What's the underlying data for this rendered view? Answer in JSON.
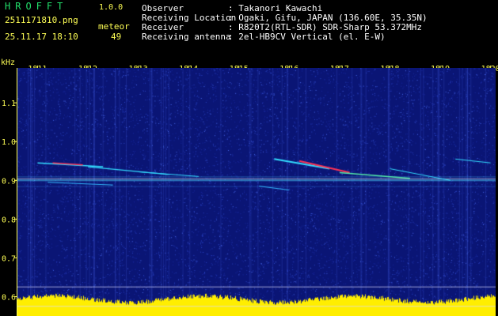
{
  "header": {
    "app_title": "HROFFT",
    "app_version": "1.0.0",
    "file_name": "2511171810.png",
    "date_time": "25.11.17 18:10",
    "meteor_label": "meteor",
    "meteor_count": "49"
  },
  "info": [
    {
      "label": "Observer",
      "value": ": Takanori Kawachi"
    },
    {
      "label": "Receiving Location",
      "value": ": Ogaki, Gifu, JAPAN (136.60E, 35.35N)"
    },
    {
      "label": "Receiver",
      "value": ": R820T2(RTL-SDR) SDR-Sharp 53.372MHz"
    },
    {
      "label": "Receiving antenna",
      "value": ": 2el-HB9CV Vertical (el. E-W)"
    }
  ],
  "axes": {
    "y_unit": "kHz",
    "x_ticks": [
      "1811",
      "1812",
      "1813",
      "1814",
      "1815",
      "1816",
      "1817",
      "1818",
      "1819",
      "1820"
    ],
    "y_ticks": [
      "1.1",
      "1.0",
      "0.9",
      "0.8",
      "0.7",
      "0.6"
    ],
    "y_tick_values": [
      1.1,
      1.0,
      0.9,
      0.8,
      0.7,
      0.6
    ],
    "y_range": [
      0.55,
      1.19
    ],
    "x_range": [
      1810.6,
      1820.1
    ]
  },
  "colors": {
    "background": "#0a1575",
    "noise_light": "#2c46c8",
    "label": "#ffff55",
    "title": "#22e06b",
    "trace_cyan": "#33ddff",
    "trace_red": "#ff3355",
    "grid": "#c8c8ff"
  }
}
